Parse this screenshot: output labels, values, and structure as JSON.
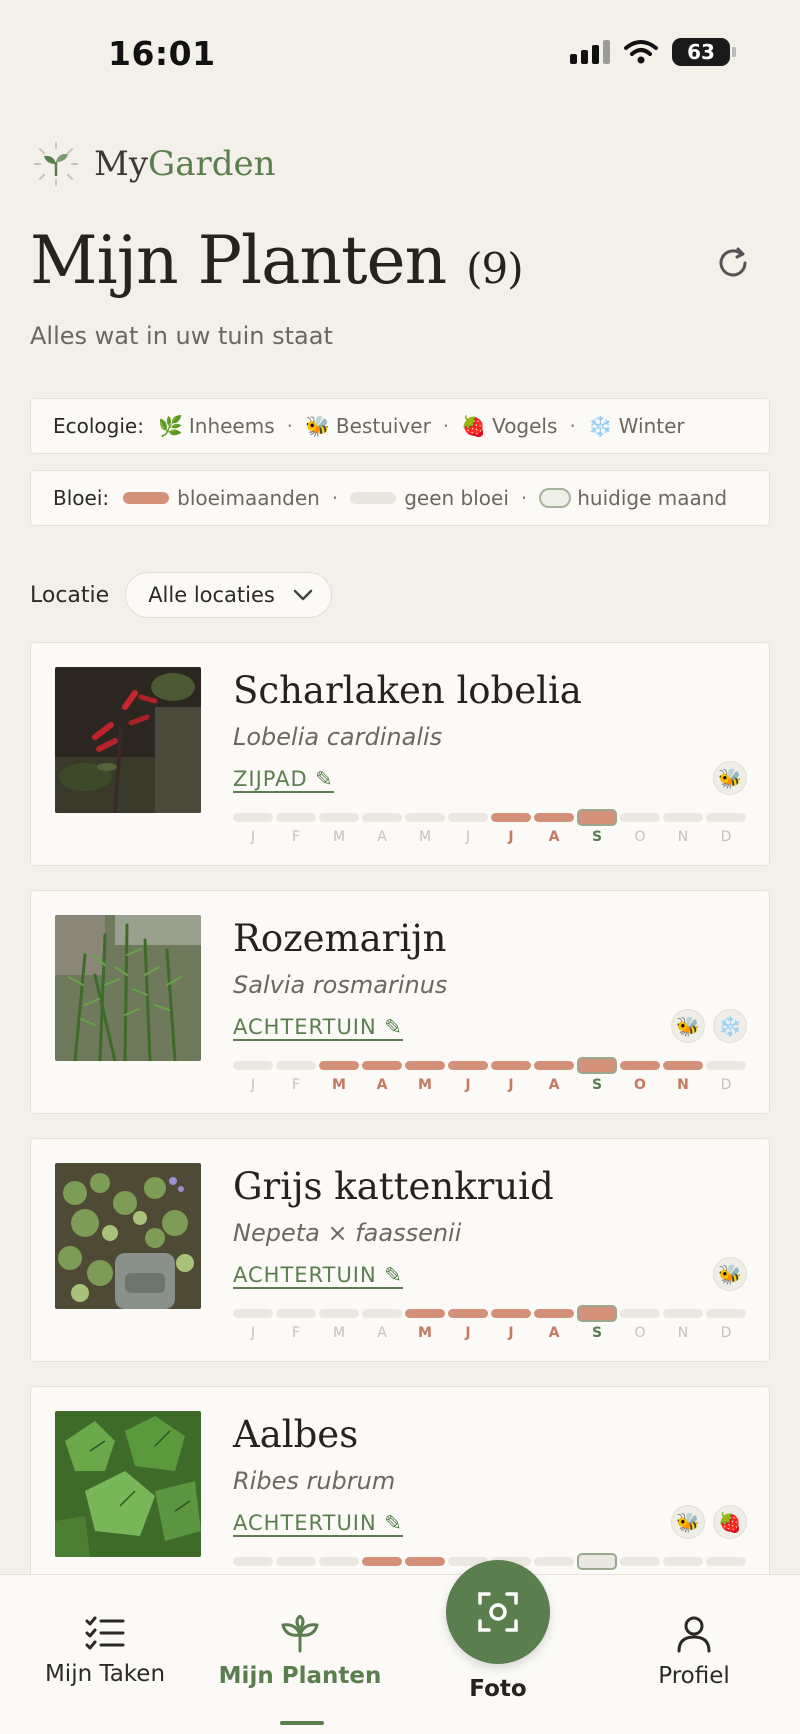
{
  "status_bar": {
    "time": "16:01",
    "battery": "63"
  },
  "brand": {
    "name_part1": "My",
    "name_part2": "Garden"
  },
  "header": {
    "title": "Mijn Planten",
    "count": "(9)",
    "subtitle": "Alles wat in uw tuin staat"
  },
  "legend_ecology": {
    "label": "Ecologie:",
    "items": [
      {
        "emoji": "🌿",
        "label": "Inheems"
      },
      {
        "emoji": "🐝",
        "label": "Bestuiver"
      },
      {
        "emoji": "🍓",
        "label": "Vogels"
      },
      {
        "emoji": "❄️",
        "label": "Winter"
      }
    ]
  },
  "legend_bloom": {
    "label": "Bloei:",
    "bloom": "bloeimaanden",
    "none": "geen bloei",
    "current": "huidige maand"
  },
  "location_filter": {
    "label": "Locatie",
    "value": "Alle locaties"
  },
  "months": [
    "J",
    "F",
    "M",
    "A",
    "M",
    "J",
    "J",
    "A",
    "S",
    "O",
    "N",
    "D"
  ],
  "current_month_index": 8,
  "plants": [
    {
      "name": "Scharlaken lobelia",
      "botanical": "Lobelia cardinalis",
      "location": "ZIJPAD ✎",
      "badges": [
        "🐝"
      ],
      "bloom": [
        6,
        7,
        8
      ]
    },
    {
      "name": "Rozemarijn",
      "botanical": "Salvia rosmarinus",
      "location": "ACHTERTUIN ✎",
      "badges": [
        "🐝",
        "❄️"
      ],
      "bloom": [
        2,
        3,
        4,
        5,
        6,
        7,
        8,
        9,
        10
      ]
    },
    {
      "name": "Grijs kattenkruid",
      "botanical": "Nepeta × faassenii",
      "location": "ACHTERTUIN ✎",
      "badges": [
        "🐝"
      ],
      "bloom": [
        4,
        5,
        6,
        7,
        8
      ]
    },
    {
      "name": "Aalbes",
      "botanical": "Ribes rubrum",
      "location": "ACHTERTUIN ✎",
      "badges": [
        "🐝",
        "🍓"
      ],
      "bloom": [
        3,
        4
      ]
    }
  ],
  "nav": {
    "tasks": "Mijn Taken",
    "plants": "Mijn Planten",
    "photo": "Foto",
    "profile": "Profiel"
  },
  "colors": {
    "accent": "#5b7e4f",
    "bloom": "#d4917a",
    "background": "#f3f0ea"
  }
}
